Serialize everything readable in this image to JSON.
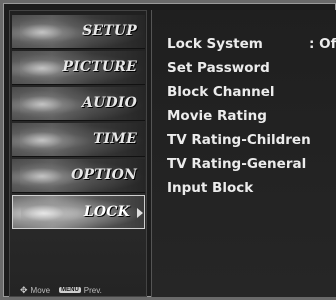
{
  "menu": {
    "items": [
      {
        "label": "SETUP",
        "active": false
      },
      {
        "label": "PICTURE",
        "active": false
      },
      {
        "label": "AUDIO",
        "active": false
      },
      {
        "label": "TIME",
        "active": false
      },
      {
        "label": "OPTION",
        "active": false
      },
      {
        "label": "LOCK",
        "active": true
      }
    ],
    "footer": {
      "move_icon": "move-icon",
      "move_label": "Move",
      "menu_key_label": "MENU",
      "prev_label": "Prev."
    }
  },
  "lock_panel": {
    "options": [
      {
        "label": "Lock System",
        "value": ": Off"
      },
      {
        "label": "Set Password"
      },
      {
        "label": "Block Channel"
      },
      {
        "label": "Movie Rating"
      },
      {
        "label": "TV Rating-Children"
      },
      {
        "label": "TV Rating-General"
      },
      {
        "label": "Input Block"
      }
    ]
  },
  "colors": {
    "background": "#1c1c1c",
    "text": "#ececec",
    "active_highlight": "#8a8a8a"
  }
}
